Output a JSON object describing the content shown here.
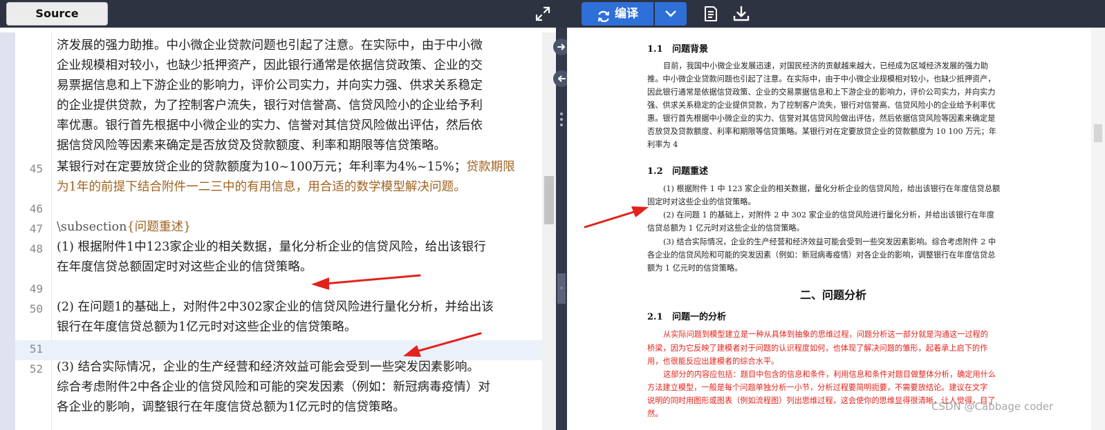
{
  "toolbar": {
    "source_label": "Source",
    "compile_label": "编译"
  },
  "editor": {
    "lines": [
      {
        "num": "",
        "text": "济发展的强力助推。中小微企业贷款问题也引起了注意。在实际中，由于中小微"
      },
      {
        "num": "",
        "text": "企业规模相对较小，也缺少抵押资产，因此银行通常是依据信贷政策、企业的交"
      },
      {
        "num": "",
        "text": "易票据信息和上下游企业的影响力，评价公司实力，并向实力强、供求关系稳定"
      },
      {
        "num": "",
        "text": "的企业提供贷款，为了控制客户流失，银行对信誉高、信贷风险小的企业给予利"
      },
      {
        "num": "",
        "text": "率优惠。银行首先根据中小微企业的实力、信誉对其信贷风险做出评估，然后依"
      },
      {
        "num": "",
        "text": "据信贷风险等因素来确定是否放贷及贷款额度、利率和期限等信贷策略。"
      },
      {
        "num": "45",
        "text": "某银行对在定要放贷企业的贷款额度为10~100万元；年利率为4%~15%；",
        "text_orange": "贷款期限"
      },
      {
        "num": "",
        "text": "为1年的前提下结合附件一二三中的有用信息，用合适的数学模型解决问题。"
      },
      {
        "num": "46",
        "text": ""
      },
      {
        "num": "47",
        "text": "\\subsection",
        "text_brace": "{问题重述}"
      },
      {
        "num": "48",
        "text": "(1) 根据附件1中123家企业的相关数据，量化分析企业的信贷风险，给出该银行"
      },
      {
        "num": "",
        "text": "在年度信贷总额固定时对这些企业的信贷策略。"
      },
      {
        "num": "49",
        "text": ""
      },
      {
        "num": "50",
        "text": "(2) 在问题1的基础上，对附件2中302家企业的信贷风险进行量化分析，并给出该"
      },
      {
        "num": "",
        "text": "银行在年度信贷总额为1亿元时对这些企业的信贷策略。"
      },
      {
        "num": "51",
        "text": ""
      },
      {
        "num": "52",
        "text": "(3) 结合实际情况，企业的生产经营和经济效益可能会受到一些突发因素影响。"
      },
      {
        "num": "",
        "text": "综合考虑附件2中各企业的信贷风险和可能的突发因素（例如：新冠病毒疫情）对"
      },
      {
        "num": "",
        "text": "各企业的影响，调整银行在年度信贷总额为1亿元时的信贷策略。"
      }
    ]
  },
  "preview": {
    "sec_1_1": {
      "num": "1.1",
      "title": "问题背景"
    },
    "bg_lines": [
      "目前，我国中小微企业发展迅速，对国民经济的贡献越来越大，已经成为区域经济发展的强力助",
      "推。中小微企业贷款问题也引起了注意。在实际中，由于中小微企业规模相对较小，也缺少抵押资产，",
      "因此银行通常是依据信贷政策、企业的交易票据信息和上下游企业的影响力，评价公司实力，并向实力",
      "强、供求关系稳定的企业提供贷款，为了控制客户流失，银行对信誉高、信贷风险小的企业给予利率优",
      "惠。银行首先根据中小微企业的实力、信誉对其信贷风险做出评估，然后依据信贷风险等因素来确定是",
      "否放贷及贷款额度、利率和期限等信贷策略。某银行对在定要放贷企业的贷款额度为 10 100 万元；年",
      "利率为 4"
    ],
    "sec_1_2": {
      "num": "1.2",
      "title": "问题重述"
    },
    "restate_lines": [
      "(1) 根据附件 1 中 123 家企业的相关数据，量化分析企业的信贷风险，给出该银行在年度信贷总额",
      "固定时对这些企业的信贷策略。",
      "(2) 在问题 1 的基础上，对附件 2 中 302 家企业的信贷风险进行量化分析，并给出该银行在年度",
      "信贷总额为 1 亿元时对这些企业的信贷策略。",
      "(3) 结合实际情况，企业的生产经营和经济效益可能会受到一些突发因素影响。综合考虑附件 2 中",
      "各企业的信贷风险和可能的突发因素（例如：新冠病毒疫情）对各企业的影响，调整银行在年度信贷总",
      "额为 1 亿元时的信贷策略。"
    ],
    "chapter_title": "二、问题分析",
    "sec_2_1": {
      "num": "2.1",
      "title": "问题一的分析"
    },
    "red_lines": [
      "从实际问题到模型建立是一种从具体到抽象的思维过程，问题分析这一部分就是沟通这一过程的",
      "桥梁，因为它反映了建模者对于问题的认识程度如何，也体现了解决问题的雏形，起着承上启下的作",
      "用，也很能反应出建模者的综合水平。",
      "这部分的内容应包括：题目中包含的信息和条件，利用信息和条件对题目做整体分析，确定用什么",
      "方法建立模型，一般是每个问题单独分析一小节，分析过程要简明扼要，不需要放结论。建议在文字",
      "说明的同时用图形或图表（例如流程图）列出思维过程，这会使你的思维显得很清晰，让人觉得，目了",
      "然。"
    ]
  },
  "watermark": "CSDN @Cabbage coder",
  "colors": {
    "toolbar_bg": "#2d3340",
    "accent_blue": "#2f6fd8",
    "annotation_red": "#e2221b",
    "orange_text": "#a0621f"
  }
}
